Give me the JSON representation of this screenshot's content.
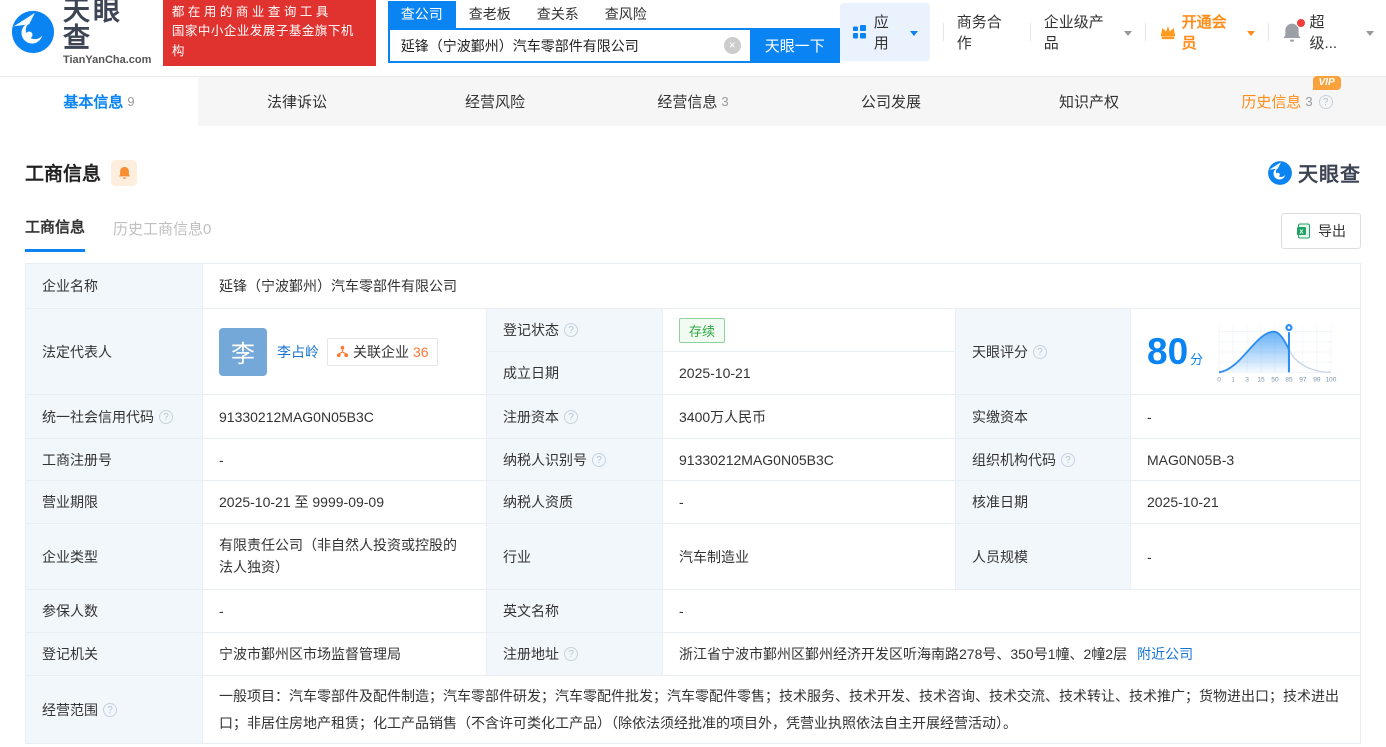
{
  "brand": {
    "name": "天眼查",
    "domain": "TianYanCha.com",
    "slogan_line1": "都在用的商业查询工具",
    "slogan_line2": "国家中小企业发展子基金旗下机构"
  },
  "icons": {
    "help": "?",
    "clear": "×"
  },
  "search": {
    "tabs": [
      "查公司",
      "查老板",
      "查关系",
      "查风险"
    ],
    "active_tab": "查公司",
    "value": "延锋（宁波鄞州）汽车零部件有限公司",
    "button_label": "天眼一下"
  },
  "topnav": {
    "apps_label": "应用",
    "business_label": "商务合作",
    "enterprise_label": "企业级产品",
    "vip_label": "开通会员",
    "account_label": "超级..."
  },
  "page_tabs": [
    {
      "label": "基本信息",
      "count": "9"
    },
    {
      "label": "法律诉讼",
      "count": ""
    },
    {
      "label": "经营风险",
      "count": ""
    },
    {
      "label": "经营信息",
      "count": "3"
    },
    {
      "label": "公司发展",
      "count": ""
    },
    {
      "label": "知识产权",
      "count": ""
    },
    {
      "label": "历史信息",
      "count": "3",
      "vip_badge": "VIP"
    }
  ],
  "section": {
    "title": "工商信息",
    "subtab_active": "工商信息",
    "subtab_history": "历史工商信息0",
    "export_label": "导出",
    "brand_mark": "天眼查"
  },
  "score": {
    "label": "天眼评分",
    "value": "80",
    "unit": "分",
    "axis": [
      "0",
      "1",
      "3",
      "15",
      "50",
      "85",
      "97",
      "99",
      "100"
    ],
    "marker_at": "85"
  },
  "fields": {
    "company_name": {
      "label": "企业名称",
      "value": "延锋（宁波鄞州）汽车零部件有限公司"
    },
    "legal_rep": {
      "label": "法定代表人",
      "avatar": "李",
      "name": "李占岭",
      "related_label": "关联企业",
      "related_count": "36"
    },
    "reg_status": {
      "label": "登记状态",
      "value": "存续"
    },
    "establish_date": {
      "label": "成立日期",
      "value": "2025-10-21"
    },
    "credit_code": {
      "label": "统一社会信用代码",
      "value": "91330212MAG0N05B3C"
    },
    "reg_capital": {
      "label": "注册资本",
      "value": "3400万人民币"
    },
    "paid_capital": {
      "label": "实缴资本",
      "value": "-"
    },
    "reg_number": {
      "label": "工商注册号",
      "value": "-"
    },
    "taxpayer_id": {
      "label": "纳税人识别号",
      "value": "91330212MAG0N05B3C"
    },
    "org_code": {
      "label": "组织机构代码",
      "value": "MAG0N05B-3"
    },
    "business_term": {
      "label": "营业期限",
      "value": "2025-10-21 至 9999-09-09"
    },
    "taxpayer_quality": {
      "label": "纳税人资质",
      "value": "-"
    },
    "approval_date": {
      "label": "核准日期",
      "value": "2025-10-21"
    },
    "company_type": {
      "label": "企业类型",
      "value": "有限责任公司（非自然人投资或控股的法人独资）"
    },
    "industry": {
      "label": "行业",
      "value": "汽车制造业"
    },
    "staff_size": {
      "label": "人员规模",
      "value": "-"
    },
    "insured_count": {
      "label": "参保人数",
      "value": "-"
    },
    "english_name": {
      "label": "英文名称",
      "value": "-"
    },
    "reg_authority": {
      "label": "登记机关",
      "value": "宁波市鄞州区市场监督管理局"
    },
    "reg_address": {
      "label": "注册地址",
      "value": "浙江省宁波市鄞州区鄞州经济开发区听海南路278号、350号1幢、2幢2层",
      "nearby_link": "附近公司"
    },
    "business_scope": {
      "label": "经营范围",
      "value": "一般项目：汽车零部件及配件制造；汽车零部件研发；汽车零配件批发；汽车零配件零售；技术服务、技术开发、技术咨询、技术交流、技术转让、技术推广；货物进出口；技术进出口；非居住房地产租赁；化工产品销售（不含许可类化工产品）（除依法须经批准的项目外，凭营业执照依法自主开展经营活动）。"
    }
  }
}
